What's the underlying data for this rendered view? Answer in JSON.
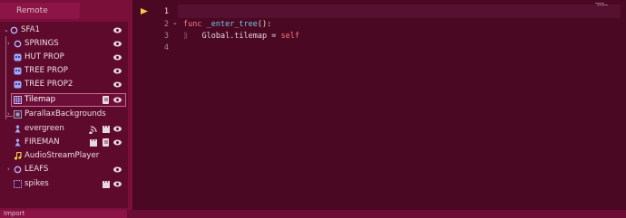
{
  "scene_dock": {
    "remote_tab": "Remote",
    "nodes": [
      {
        "label": "SFA1",
        "type": "root",
        "expandable": true,
        "expanded": true
      },
      {
        "label": "SPRINGS",
        "type": "node2d",
        "expandable": true
      },
      {
        "label": "HUT PROP",
        "type": "sprite"
      },
      {
        "label": "TREE PROP",
        "type": "sprite"
      },
      {
        "label": "TREE PROP2",
        "type": "sprite"
      },
      {
        "label": "Tilemap",
        "type": "tilemap",
        "selected": true
      },
      {
        "label": "ParallaxBackgrounds",
        "type": "parallax",
        "expandable": true
      },
      {
        "label": "evergreen",
        "type": "character"
      },
      {
        "label": "FIREMAN",
        "type": "character"
      },
      {
        "label": "AudioStreamPlayer",
        "type": "audio"
      },
      {
        "label": "LEAFS",
        "type": "node2d",
        "expandable": true
      },
      {
        "label": "spikes",
        "type": "area"
      }
    ]
  },
  "editor": {
    "line_numbers": [
      "1",
      "2",
      "3",
      "4"
    ],
    "code_line2_kw": "func",
    "code_line2_fn": "_enter_tree",
    "code_line2_rest": "():",
    "code_line3_text": "Global.tilemap = ",
    "code_line3_kw": "self",
    "indent_marker": "⟫"
  },
  "bottom": {
    "import_label": "Import"
  },
  "colors": {
    "accent": "#c46b90",
    "panel_bg": "#5e0a2d",
    "editor_bg": "#4a0822",
    "keyword": "#ff7a8a",
    "function": "#74c7ec"
  }
}
